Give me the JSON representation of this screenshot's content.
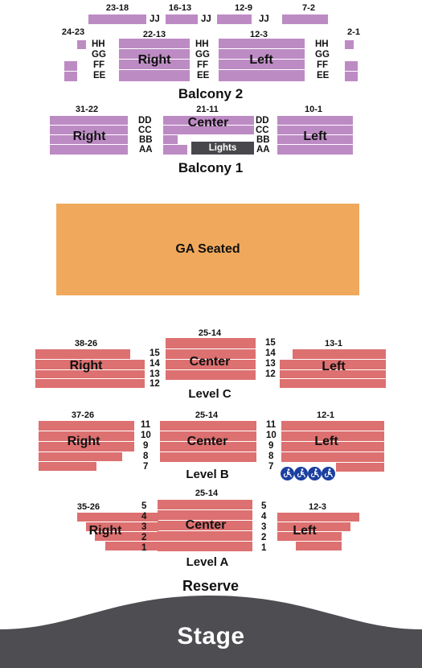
{
  "venue_map": {
    "colors": {
      "balcony_seat": "#bd8bc4",
      "reserve_seat": "#dd7070",
      "ga_seat": "#f0a95c",
      "lights_box": "#48484c",
      "stage": "#4d4d52",
      "accessible_icon": "#1a3fa0",
      "text": "#111111",
      "background": "#ffffff"
    },
    "areas": [
      {
        "id": "balcony2",
        "label": "Balcony 2",
        "top_row_letter": "JJ",
        "top_row_ranges": [
          "23-18",
          "16-13",
          "12-9",
          "7-2"
        ],
        "row_letters": [
          "HH",
          "GG",
          "FF",
          "EE"
        ],
        "outer_left_range": "24-23",
        "outer_right_range": "2-1",
        "sections": [
          {
            "name": "Right",
            "range": "22-13"
          },
          {
            "name": "Left",
            "range": "12-3"
          }
        ]
      },
      {
        "id": "balcony1",
        "label": "Balcony 1",
        "row_letters": [
          "DD",
          "CC",
          "BB",
          "AA"
        ],
        "lights_label": "Lights",
        "sections": [
          {
            "name": "Right",
            "range": "31-22"
          },
          {
            "name": "Center",
            "range": "21-11"
          },
          {
            "name": "Left",
            "range": "10-1"
          }
        ]
      },
      {
        "id": "ga",
        "label": "GA Seated"
      },
      {
        "id": "reserve",
        "label": "Reserve",
        "levels": [
          {
            "id": "levelC",
            "label": "Level C",
            "row_numbers": [
              "15",
              "14",
              "13",
              "12"
            ],
            "sections": [
              {
                "name": "Right",
                "range": "38-26"
              },
              {
                "name": "Center",
                "range": "25-14"
              },
              {
                "name": "Left",
                "range": "13-1"
              }
            ]
          },
          {
            "id": "levelB",
            "label": "Level B",
            "row_numbers": [
              "11",
              "10",
              "9",
              "8",
              "7"
            ],
            "accessible_seat_count": 4,
            "sections": [
              {
                "name": "Right",
                "range": "37-26"
              },
              {
                "name": "Center",
                "range": "25-14"
              },
              {
                "name": "Left",
                "range": "12-1"
              }
            ]
          },
          {
            "id": "levelA",
            "label": "Level A",
            "row_numbers": [
              "5",
              "4",
              "3",
              "2",
              "1"
            ],
            "sections": [
              {
                "name": "Right",
                "range": "35-26"
              },
              {
                "name": "Center",
                "range": "25-14"
              },
              {
                "name": "Left",
                "range": "12-3"
              }
            ]
          }
        ]
      },
      {
        "id": "stage",
        "label": "Stage"
      }
    ]
  }
}
